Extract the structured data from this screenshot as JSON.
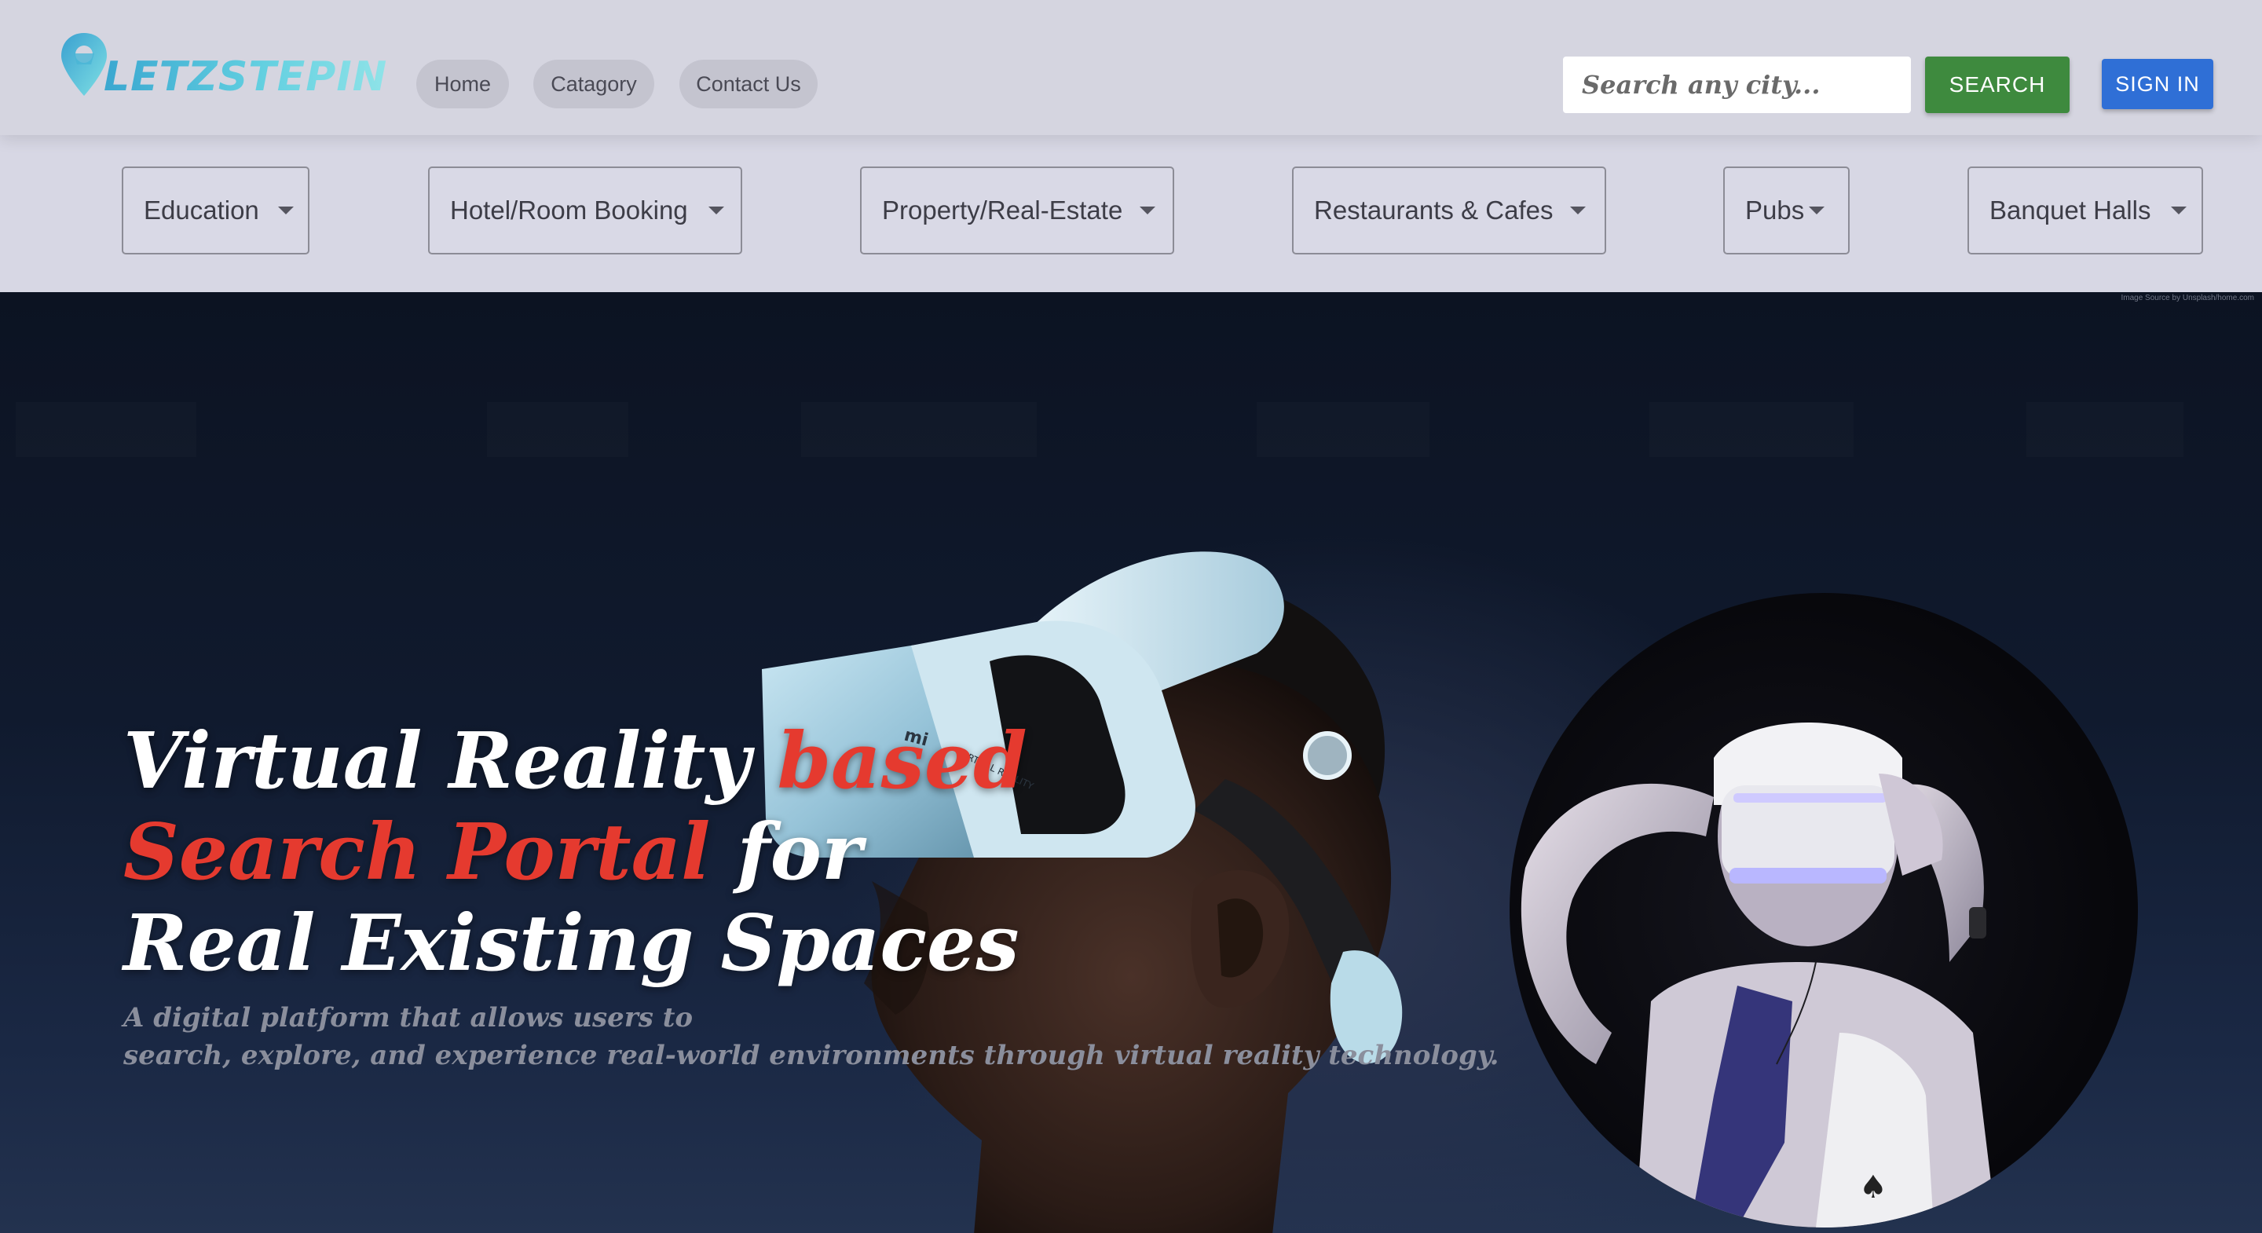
{
  "brand": {
    "name": "LETZSTEPIN"
  },
  "nav": {
    "links": [
      "Home",
      "Catagory",
      "Contact Us"
    ]
  },
  "search": {
    "placeholder": "Search any city...",
    "button_label": "SEARCH"
  },
  "auth": {
    "signin_label": "SIGN IN"
  },
  "categories": [
    "Education",
    "Hotel/Room Booking",
    "Property/Real-Estate",
    "Restaurants & Cafes",
    "Pubs",
    "Banquet Halls"
  ],
  "hero": {
    "credit": "Image Source by Unsplash/home.com",
    "headline": {
      "part1": "Virtual Reality ",
      "part2_red": "based",
      "part3_red": "Search Portal",
      "part4": " for",
      "part5": "Real Existing Spaces"
    },
    "subtext": {
      "line1": "A digital platform that allows users to",
      "line2": "search, explore, and experience real-world environments through virtual reality technology."
    },
    "headset_brand": "mi",
    "headset_text": "VIRTUAL REALITY"
  },
  "colors": {
    "accent_red": "#e53a2f",
    "search_green": "#3e8a3e",
    "signin_blue": "#2f6fd6",
    "logo_teal": "#5fc3d9"
  }
}
